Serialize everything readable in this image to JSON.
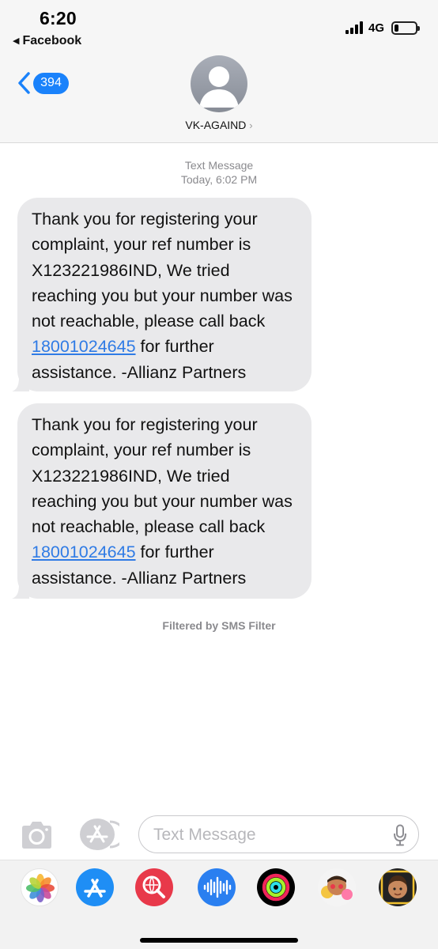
{
  "status_bar": {
    "time": "6:20",
    "back_app": "Facebook",
    "network": "4G",
    "battery_level": 0.2
  },
  "nav": {
    "unread_count": "394",
    "contact_name": "VK-AGAIND",
    "contact_chevron": "›"
  },
  "conversation": {
    "service_label": "Text Message",
    "timestamp": "Today, 6:02 PM",
    "messages": [
      {
        "before_link": "Thank you for registering your complaint, your ref number is X123221986IND, We tried reaching you but your number was not reachable, please call back ",
        "link": "18001024645",
        "after_link": " for further assistance. -Allianz Partners"
      },
      {
        "before_link": "Thank you for registering your complaint, your ref number is X123221986IND, We tried reaching you but your number was not reachable, please call back ",
        "link": "18001024645",
        "after_link": " for further assistance. -Allianz Partners"
      }
    ],
    "filter_note": "Filtered by SMS Filter"
  },
  "composer": {
    "placeholder": "Text Message",
    "camera_icon": "camera-icon",
    "apps_icon": "app-store-icon",
    "mic_icon": "microphone-icon"
  },
  "app_tray": {
    "apps": [
      "photos-icon",
      "app-store-icon",
      "web-search-icon",
      "audio-message-icon",
      "activity-icon",
      "memoji-stickers-icon",
      "memoji-icon"
    ]
  },
  "colors": {
    "accent_blue": "#1a82fb",
    "bubble_gray": "#e9e9eb",
    "link_blue": "#2f7be5"
  }
}
